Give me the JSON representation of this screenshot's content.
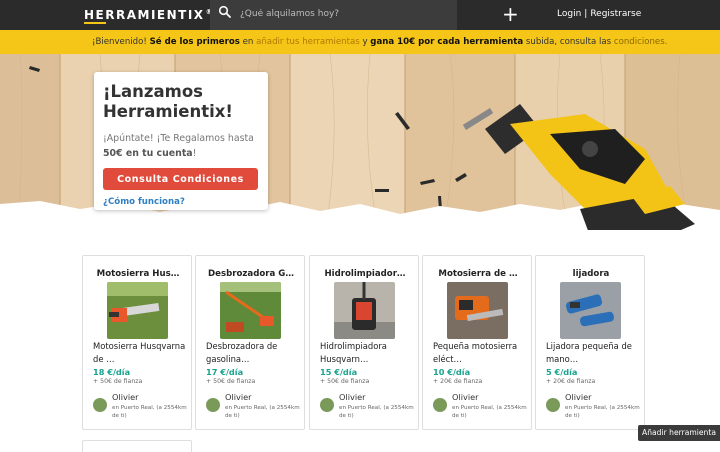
{
  "nav": {
    "logo": "HERRAMIENTIX",
    "logo_mark": "®",
    "search_placeholder": "¿Qué alquilamos hoy?",
    "plus_label": "+",
    "login": "Login",
    "separator": "|",
    "register": "Registrarse",
    "search_icon": "search-icon"
  },
  "banner": {
    "t1": "¡Bienvenido! ",
    "t2": "Sé de los primeros",
    "t3": " en ",
    "t4": "añadir tus herramientas",
    "t5": " y ",
    "t6": "gana 10€ por cada herramienta",
    "t7": " subida, consulta las ",
    "t8": "condiciones."
  },
  "hero": {
    "title": "¡Lanzamos Herramientix!",
    "sub1": "¡Apúntate! ¡Te Regalamos hasta ",
    "sub_bold": "50€ en tu cuenta",
    "sub2": "!",
    "button": "Consulta Condiciones",
    "link": "¿Cómo funciona?"
  },
  "listings": [
    {
      "title": "Motosierra Hus…",
      "desc": "Motosierra Husqvarna de …",
      "price": "18 €/día",
      "deposit": "+ 50€ de fianza",
      "owner": "Olivier",
      "location": "en Puerto Real, (a 2554km de ti)"
    },
    {
      "title": "Desbrozadora G…",
      "desc": "Desbrozadora de gasolina…",
      "price": "17 €/día",
      "deposit": "+ 50€ de fianza",
      "owner": "Olivier",
      "location": "en Puerto Real, (a 2554km de ti)"
    },
    {
      "title": "Hidrolimpiador…",
      "desc": "Hidrolimpiadora Husqvarn…",
      "price": "15 €/día",
      "deposit": "+ 50€ de fianza",
      "owner": "Olivier",
      "location": "en Puerto Real, (a 2554km de ti)"
    },
    {
      "title": "Motosierra de …",
      "desc": "Pequeña motosierra eléct…",
      "price": "10 €/día",
      "deposit": "+ 20€ de fianza",
      "owner": "Olivier",
      "location": "en Puerto Real, (a 2554km de ti)"
    },
    {
      "title": "lijadora",
      "desc": "Lijadora pequeña de mano…",
      "price": "5 €/día",
      "deposit": "+ 20€ de fianza",
      "owner": "Olivier",
      "location": "en Puerto Real, (a 2554km de ti)"
    }
  ],
  "add_tool": "Añadir herramienta",
  "colors": {
    "accent": "#f5c518",
    "cta": "#e04b3c",
    "price": "#1aa38e",
    "link": "#2f7fc4",
    "nav": "#2b2b2b"
  }
}
